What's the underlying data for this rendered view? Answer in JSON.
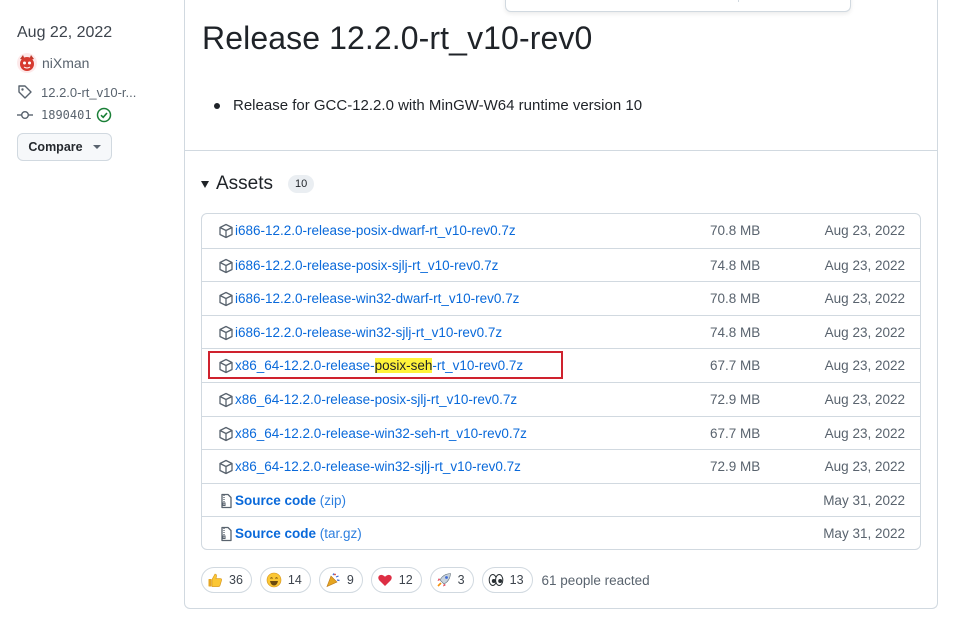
{
  "sidebar": {
    "date": "Aug 22, 2022",
    "author": "niXman",
    "tag": "12.2.0-rt_v10-r...",
    "commit": "1890401",
    "compare_label": "Compare"
  },
  "release": {
    "title": "Release 12.2.0-rt_v10-rev0",
    "notes": [
      "Release for GCC-12.2.0 with MinGW-W64 runtime version 10"
    ]
  },
  "assets": {
    "title": "Assets",
    "count": "10",
    "rows": [
      {
        "name": "i686-12.2.0-release-posix-dwarf-rt_v10-rev0.7z",
        "size": "70.8 MB",
        "date": "Aug 23, 2022"
      },
      {
        "name": "i686-12.2.0-release-posix-sjlj-rt_v10-rev0.7z",
        "size": "74.8 MB",
        "date": "Aug 23, 2022"
      },
      {
        "name": "i686-12.2.0-release-win32-dwarf-rt_v10-rev0.7z",
        "size": "70.8 MB",
        "date": "Aug 23, 2022"
      },
      {
        "name": "i686-12.2.0-release-win32-sjlj-rt_v10-rev0.7z",
        "size": "74.8 MB",
        "date": "Aug 23, 2022"
      },
      {
        "name_pre": "x86_64-12.2.0-release-",
        "name_hl": "posix-seh",
        "name_post": "-rt_v10-rev0.7z",
        "size": "67.7 MB",
        "date": "Aug 23, 2022"
      },
      {
        "name": "x86_64-12.2.0-release-posix-sjlj-rt_v10-rev0.7z",
        "size": "72.9 MB",
        "date": "Aug 23, 2022"
      },
      {
        "name": "x86_64-12.2.0-release-win32-seh-rt_v10-rev0.7z",
        "size": "67.7 MB",
        "date": "Aug 23, 2022"
      },
      {
        "name": "x86_64-12.2.0-release-win32-sjlj-rt_v10-rev0.7z",
        "size": "72.9 MB",
        "date": "Aug 23, 2022"
      },
      {
        "name": "Source code",
        "suffix": "(zip)",
        "size": "",
        "date": "May 31, 2022"
      },
      {
        "name": "Source code",
        "suffix": "(tar.gz)",
        "size": "",
        "date": "May 31, 2022"
      }
    ]
  },
  "reactions": {
    "items": [
      {
        "icon": "thumbs-up-icon",
        "count": "36"
      },
      {
        "icon": "laugh-icon",
        "count": "14"
      },
      {
        "icon": "hooray-icon",
        "count": "9"
      },
      {
        "icon": "heart-icon",
        "count": "12"
      },
      {
        "icon": "rocket-icon",
        "count": "3"
      },
      {
        "icon": "eyes-icon",
        "count": "13"
      }
    ],
    "summary": "61 people reacted"
  },
  "colors": {
    "link": "#0969da",
    "highlight": "#fff33a",
    "annotation_box": "#cf222e",
    "check": "#1a7f37"
  }
}
